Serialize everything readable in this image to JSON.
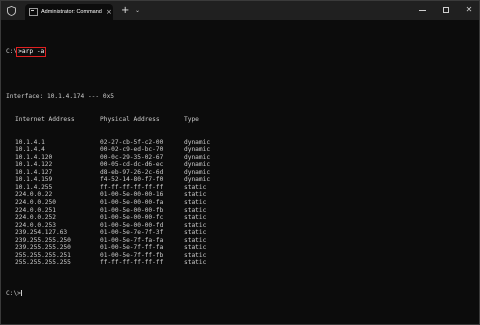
{
  "titlebar": {
    "tab_title": "Administrator: Command Prom",
    "tab_close": "×",
    "new_tab": "+",
    "dropdown": "⌄",
    "minimize": "",
    "maximize": "",
    "close": "✕"
  },
  "console": {
    "prompt": "C:\\",
    "command": ">arp -a",
    "interface_line": "Interface: 10.1.4.174 --- 0x5",
    "headers": {
      "ip": "Internet Address",
      "mac": "Physical Address",
      "type": "Type"
    },
    "rows": [
      {
        "ip": "10.1.4.1",
        "mac": "02-27-cb-5f-c2-00",
        "type": "dynamic"
      },
      {
        "ip": "10.1.4.4",
        "mac": "00-02-c9-ed-bc-70",
        "type": "dynamic"
      },
      {
        "ip": "10.1.4.120",
        "mac": "00-0c-29-35-02-67",
        "type": "dynamic"
      },
      {
        "ip": "10.1.4.122",
        "mac": "00-05-cd-dc-d6-ec",
        "type": "dynamic"
      },
      {
        "ip": "10.1.4.127",
        "mac": "d8-eb-97-26-2c-6d",
        "type": "dynamic"
      },
      {
        "ip": "10.1.4.159",
        "mac": "f4-52-14-80-f7-f0",
        "type": "dynamic"
      },
      {
        "ip": "10.1.4.255",
        "mac": "ff-ff-ff-ff-ff-ff",
        "type": "static"
      },
      {
        "ip": "224.0.0.22",
        "mac": "01-00-5e-00-00-16",
        "type": "static"
      },
      {
        "ip": "224.0.0.250",
        "mac": "01-00-5e-00-00-fa",
        "type": "static"
      },
      {
        "ip": "224.0.0.251",
        "mac": "01-00-5e-00-00-fb",
        "type": "static"
      },
      {
        "ip": "224.0.0.252",
        "mac": "01-00-5e-00-00-fc",
        "type": "static"
      },
      {
        "ip": "224.0.0.253",
        "mac": "01-00-5e-00-00-fd",
        "type": "static"
      },
      {
        "ip": "239.254.127.63",
        "mac": "01-00-5e-7e-7f-3f",
        "type": "static"
      },
      {
        "ip": "239.255.255.250",
        "mac": "01-00-5e-7f-fa-fa",
        "type": "static"
      },
      {
        "ip": "239.255.255.250",
        "mac": "01-00-5e-7f-ff-fa",
        "type": "static"
      },
      {
        "ip": "255.255.255.251",
        "mac": "01-00-5e-7f-ff-fb",
        "type": "static"
      },
      {
        "ip": "255.255.255.255",
        "mac": "ff-ff-ff-ff-ff-ff",
        "type": "static"
      }
    ],
    "final_prompt": "C:\\>"
  },
  "colors": {
    "background": "#0c0c0c",
    "titlebar": "#202020",
    "text": "#cccccc",
    "highlight_box": "#e02020"
  }
}
